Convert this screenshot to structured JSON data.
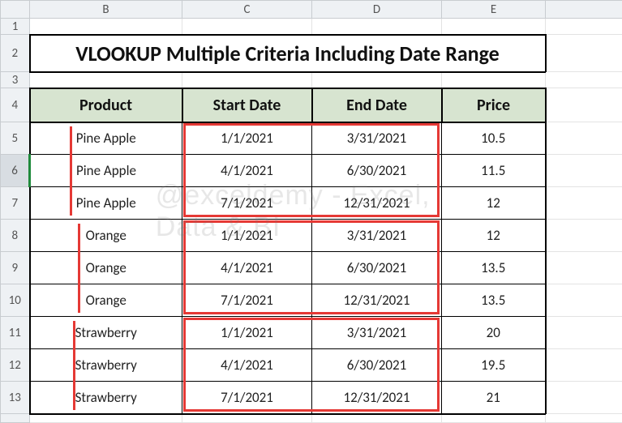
{
  "watermark": "@exceldemy - Excel, Data & BI",
  "columns": [
    "B",
    "C",
    "D",
    "E"
  ],
  "rows": [
    "1",
    "2",
    "3",
    "4",
    "5",
    "6",
    "7",
    "8",
    "9",
    "10",
    "11",
    "12",
    "13"
  ],
  "selected_row": "6",
  "title": "VLOOKUP Multiple Criteria Including Date Range",
  "headers": {
    "product": "Product",
    "start": "Start Date",
    "end": "End Date",
    "price": "Price"
  },
  "data": [
    {
      "product": "Pine Apple",
      "start": "1/1/2021",
      "end": "3/31/2021",
      "price": "10.5"
    },
    {
      "product": "Pine Apple",
      "start": "4/1/2021",
      "end": "6/30/2021",
      "price": "11.5"
    },
    {
      "product": "Pine Apple",
      "start": "7/1/2021",
      "end": "12/31/2021",
      "price": "12"
    },
    {
      "product": "Orange",
      "start": "1/1/2021",
      "end": "3/31/2021",
      "price": "12"
    },
    {
      "product": "Orange",
      "start": "4/1/2021",
      "end": "6/30/2021",
      "price": "13.5"
    },
    {
      "product": "Orange",
      "start": "7/1/2021",
      "end": "12/31/2021",
      "price": "13.5"
    },
    {
      "product": "Strawberry",
      "start": "1/1/2021",
      "end": "3/31/2021",
      "price": "20"
    },
    {
      "product": "Strawberry",
      "start": "4/1/2021",
      "end": "6/30/2021",
      "price": "19.5"
    },
    {
      "product": "Strawberry",
      "start": "7/1/2021",
      "end": "12/31/2021",
      "price": "21"
    }
  ],
  "chart_data": {
    "type": "table",
    "title": "VLOOKUP Multiple Criteria Including Date Range",
    "columns": [
      "Product",
      "Start Date",
      "End Date",
      "Price"
    ],
    "rows": [
      [
        "Pine Apple",
        "1/1/2021",
        "3/31/2021",
        10.5
      ],
      [
        "Pine Apple",
        "4/1/2021",
        "6/30/2021",
        11.5
      ],
      [
        "Pine Apple",
        "7/1/2021",
        "12/31/2021",
        12
      ],
      [
        "Orange",
        "1/1/2021",
        "3/31/2021",
        12
      ],
      [
        "Orange",
        "4/1/2021",
        "6/30/2021",
        13.5
      ],
      [
        "Orange",
        "7/1/2021",
        "12/31/2021",
        13.5
      ],
      [
        "Strawberry",
        "1/1/2021",
        "3/31/2021",
        20
      ],
      [
        "Strawberry",
        "4/1/2021",
        "6/30/2021",
        19.5
      ],
      [
        "Strawberry",
        "7/1/2021",
        "12/31/2021",
        21
      ]
    ],
    "highlights": {
      "date_range_groups": [
        [
          0,
          1,
          2
        ],
        [
          3,
          4,
          5
        ],
        [
          6,
          7,
          8
        ]
      ],
      "product_groups": [
        [
          0,
          1,
          2
        ],
        [
          3,
          4,
          5
        ],
        [
          6,
          7,
          8
        ]
      ]
    }
  }
}
